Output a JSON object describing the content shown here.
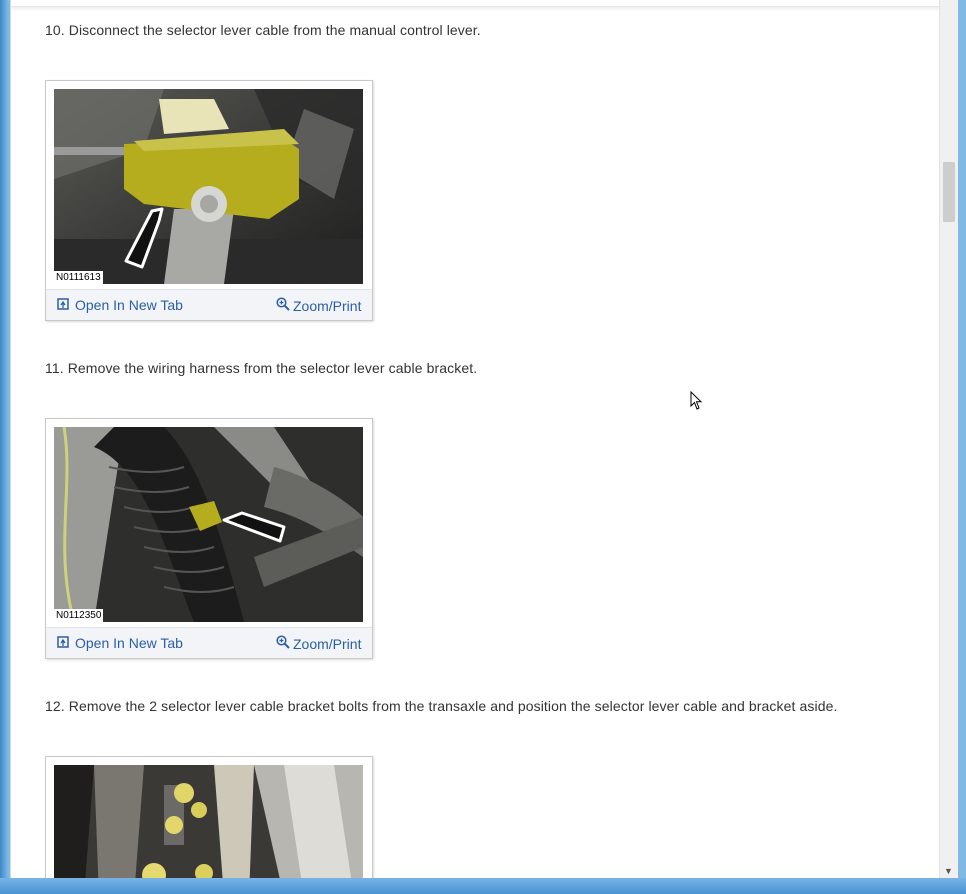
{
  "steps": [
    {
      "text": "10. Disconnect the selector lever cable from the manual control lever.",
      "figure_code": "N0111613"
    },
    {
      "text": "11. Remove the wiring harness from the selector lever cable bracket.",
      "figure_code": "N0112350"
    },
    {
      "text": "12. Remove the 2 selector lever cable bracket bolts from the transaxle and position the selector lever cable and bracket aside."
    }
  ],
  "actions": {
    "open_new_tab": "Open In New Tab",
    "zoom_print": "Zoom/Print"
  },
  "icons": {
    "open_new_tab": "open-new-tab-icon",
    "zoom": "zoom-in-icon"
  },
  "colors": {
    "link": "#2a5ea8",
    "highlight": "#b5ad1e",
    "frame": "#4a93d3"
  }
}
